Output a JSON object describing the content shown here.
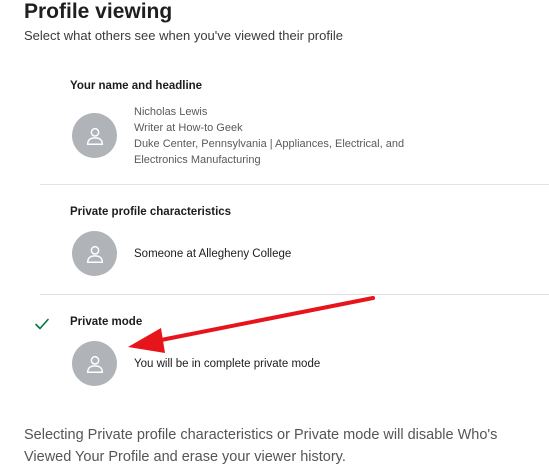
{
  "header": {
    "title": "Profile viewing",
    "subtitle": "Select what others see when you've viewed their profile"
  },
  "options": [
    {
      "heading": "Your name and headline",
      "details": [
        "Nicholas Lewis",
        "Writer at How-to Geek",
        "Duke Center, Pennsylvania | Appliances, Electrical, and",
        "Electronics Manufacturing"
      ],
      "selected": false
    },
    {
      "heading": "Private profile characteristics",
      "description": "Someone at Allegheny College",
      "selected": false
    },
    {
      "heading": "Private mode",
      "description": "You will be in complete private mode",
      "selected": true
    }
  ],
  "footer": "Selecting Private profile characteristics or Private mode will disable Who's Viewed Your Profile and erase your viewer history.",
  "colors": {
    "avatar_bg": "#b0b4b8",
    "check": "#057642",
    "annotation_arrow": "#e8141b"
  },
  "icons": {
    "avatar": "person-silhouette-icon",
    "selected": "checkmark-icon"
  }
}
